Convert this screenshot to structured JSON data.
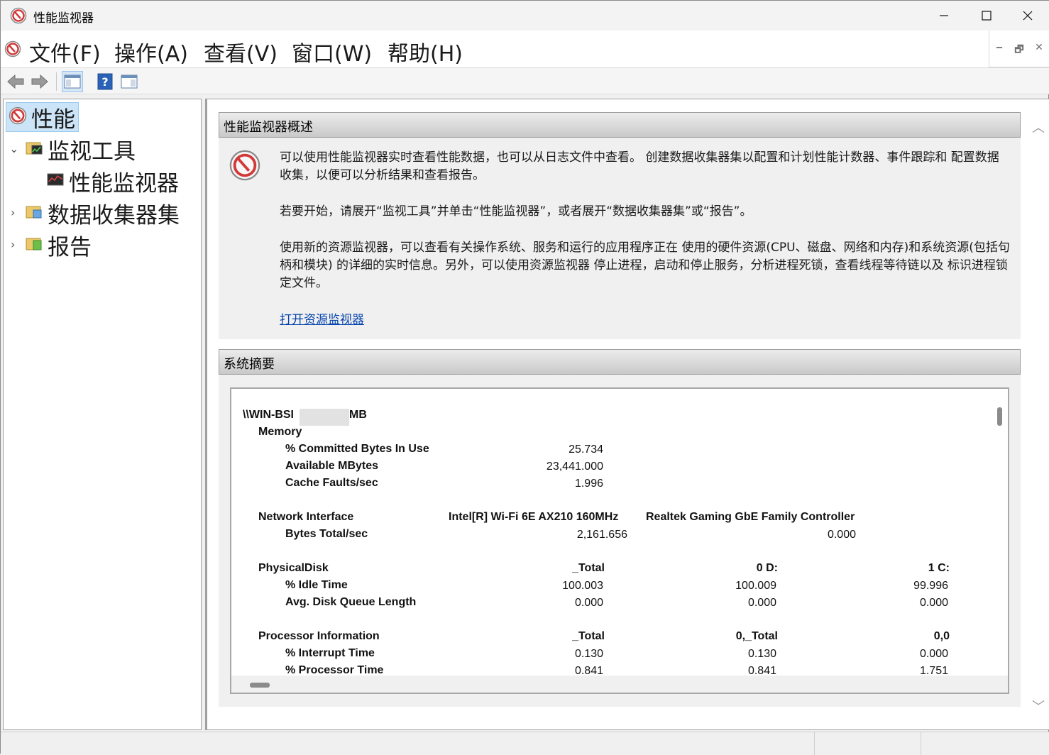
{
  "window": {
    "title": "性能监视器"
  },
  "menu": [
    "文件(F)",
    "操作(A)",
    "查看(V)",
    "窗口(W)",
    "帮助(H)"
  ],
  "mdi_buttons": {
    "minimize": "‒",
    "restore": "🗗",
    "close": "✕"
  },
  "tree": {
    "items": [
      {
        "label": "性能"
      },
      {
        "label": "监视工具"
      },
      {
        "label": "性能监视器"
      },
      {
        "label": "数据收集器集"
      },
      {
        "label": "报告"
      }
    ]
  },
  "overview": {
    "heading": "性能监视器概述",
    "p1": "可以使用性能监视器实时查看性能数据，也可以从日志文件中查看。 创建数据收集器集以配置和计划性能计数器、事件跟踪和 配置数据收集，以便可以分析结果和查看报告。",
    "p2": "若要开始，请展开“监视工具”并单击“性能监视器”，或者展开“数据收集器集”或“报告”。",
    "p3": "使用新的资源监视器，可以查看有关操作系统、服务和运行的应用程序正在 使用的硬件资源(CPU、磁盘、网络和内存)和系统资源(包括句柄和模块) 的详细的实时信息。另外，可以使用资源监视器 停止进程，启动和停止服务，分析进程死锁，查看线程等待链以及 标识进程锁定文件。",
    "link": "打开资源监视器"
  },
  "summary": {
    "heading": "系统摘要",
    "host_prefix": "\\\\WIN-BSI",
    "host_suffix": "MB",
    "memory": {
      "title": "Memory",
      "rows": [
        {
          "name": "% Committed Bytes In Use",
          "value": "25.734"
        },
        {
          "name": "Available MBytes",
          "value": "23,441.000"
        },
        {
          "name": "Cache Faults/sec",
          "value": "1.996"
        }
      ]
    },
    "network": {
      "title": "Network Interface",
      "col1": "Intel[R] Wi-Fi 6E AX210 160MHz",
      "col2": "Realtek Gaming GbE Family Controller",
      "row_name": "Bytes Total/sec",
      "v1": "2,161.656",
      "v2": "0.000"
    },
    "disk": {
      "title": "PhysicalDisk",
      "cols": [
        "_Total",
        "0 D:",
        "1 C:"
      ],
      "rows": [
        {
          "name": "% Idle Time",
          "values": [
            "100.003",
            "100.009",
            "99.996"
          ]
        },
        {
          "name": "Avg. Disk Queue Length",
          "values": [
            "0.000",
            "0.000",
            "0.000"
          ]
        }
      ]
    },
    "processor": {
      "title": "Processor Information",
      "cols": [
        "_Total",
        "0,_Total",
        "0,0"
      ],
      "rows": [
        {
          "name": "% Interrupt Time",
          "values": [
            "0.130",
            "0.130",
            "0.000"
          ]
        },
        {
          "name": "% Processor Time",
          "values": [
            "0.841",
            "0.841",
            "1.751"
          ]
        }
      ]
    }
  }
}
